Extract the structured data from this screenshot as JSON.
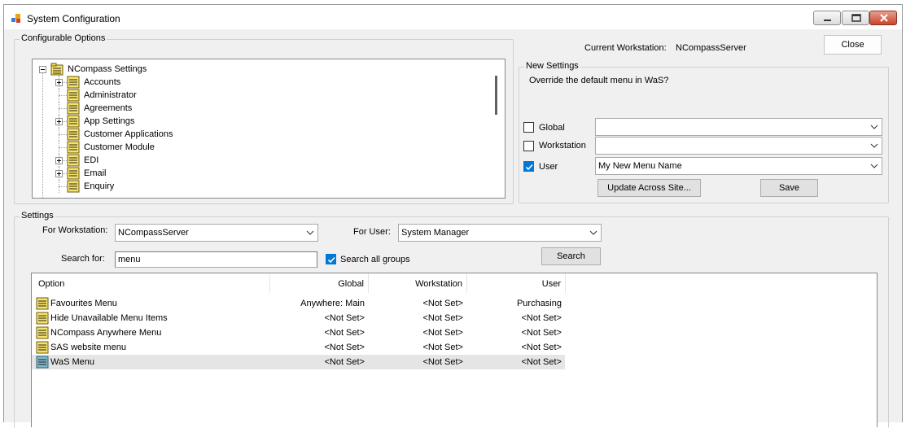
{
  "window": {
    "title": "System Configuration"
  },
  "configurable_options": {
    "legend": "Configurable Options",
    "tree": {
      "root": "NCompass Settings",
      "items": [
        {
          "label": "Accounts",
          "expandable": true
        },
        {
          "label": "Administrator",
          "expandable": false
        },
        {
          "label": "Agreements",
          "expandable": false
        },
        {
          "label": "App Settings",
          "expandable": true
        },
        {
          "label": "Customer Applications",
          "expandable": false
        },
        {
          "label": "Customer Module",
          "expandable": false
        },
        {
          "label": "EDI",
          "expandable": true
        },
        {
          "label": "Email",
          "expandable": true
        },
        {
          "label": "Enquiry",
          "expandable": false
        }
      ]
    }
  },
  "current_workstation": {
    "label": "Current Workstation:",
    "value": "NCompassServer"
  },
  "close_button": "Close",
  "new_settings": {
    "legend": "New Settings",
    "question": "Override the default menu in WaS?",
    "global": {
      "label": "Global",
      "checked": false,
      "value": ""
    },
    "workstation": {
      "label": "Workstation",
      "checked": false,
      "value": ""
    },
    "user": {
      "label": "User",
      "checked": true,
      "value": "My New Menu Name"
    },
    "update_button": "Update Across Site...",
    "save_button": "Save"
  },
  "settings": {
    "legend": "Settings",
    "for_workstation_label": "For Workstation:",
    "for_workstation_value": "NCompassServer",
    "for_user_label": "For User:",
    "for_user_value": "System Manager",
    "search_for_label": "Search for:",
    "search_value": "menu",
    "search_all_groups": {
      "label": "Search all groups",
      "checked": true
    },
    "search_button": "Search",
    "columns": [
      "Option",
      "Global",
      "Workstation",
      "User"
    ],
    "rows": [
      {
        "option": "Favourites Menu",
        "global": "Anywhere: Main",
        "workstation": "<Not Set>",
        "user": "Purchasing",
        "selected": false
      },
      {
        "option": "Hide Unavailable Menu Items",
        "global": "<Not Set>",
        "workstation": "<Not Set>",
        "user": "<Not Set>",
        "selected": false
      },
      {
        "option": "NCompass Anywhere Menu",
        "global": "<Not Set>",
        "workstation": "<Not Set>",
        "user": "<Not Set>",
        "selected": false
      },
      {
        "option": "SAS website menu",
        "global": "<Not Set>",
        "workstation": "<Not Set>",
        "user": "<Not Set>",
        "selected": false
      },
      {
        "option": "WaS Menu",
        "global": "<Not Set>",
        "workstation": "<Not Set>",
        "user": "<Not Set>",
        "selected": true
      }
    ]
  },
  "colors": {
    "check_blue": "#0078d7",
    "folder_yellow": "#f5e36a",
    "selected_row": "#e5e5e5"
  }
}
